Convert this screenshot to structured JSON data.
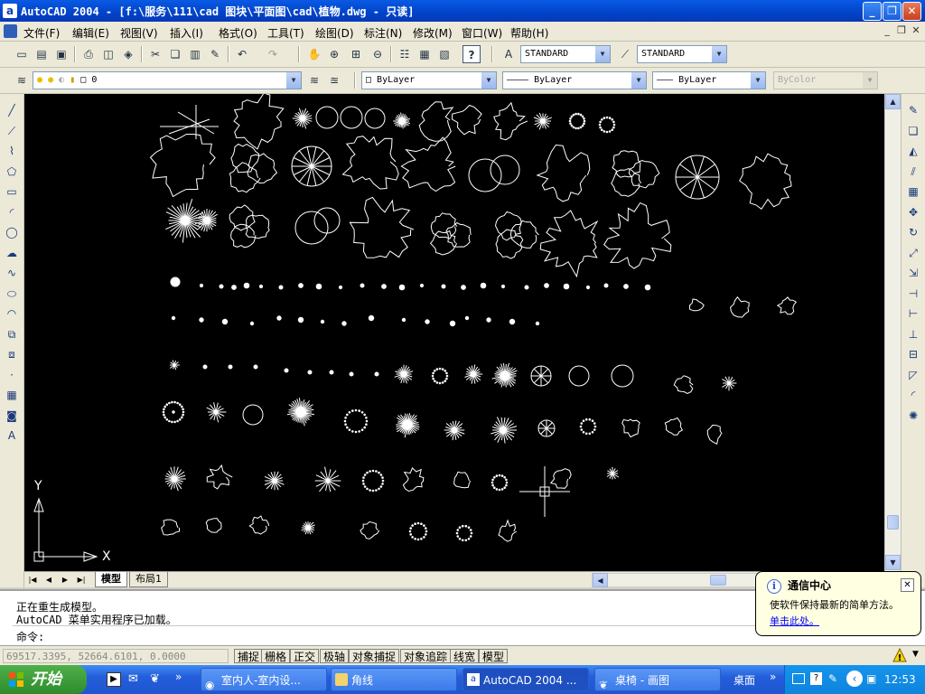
{
  "window": {
    "title": "AutoCAD 2004 - [f:\\服务\\111\\cad 图块\\平面图\\cad\\植物.dwg - 只读]",
    "app_icon": "a",
    "min_glyph": "_",
    "max_glyph": "❐",
    "close_glyph": "✕"
  },
  "menu": {
    "items": [
      "文件(F)",
      "编辑(E)",
      "视图(V)",
      "插入(I)",
      "格式(O)",
      "工具(T)",
      "绘图(D)",
      "标注(N)",
      "修改(M)",
      "窗口(W)",
      "帮助(H)"
    ],
    "mdi_min": "_",
    "mdi_restore": "❐",
    "mdi_close": "✕"
  },
  "toolbar_standard": {
    "text_style": "STANDARD",
    "dim_style": "STANDARD",
    "arrow": "▼",
    "help_glyph": "?"
  },
  "toolbar_layers": {
    "layer_name": "0",
    "color": "ByLayer",
    "linetype": "ByLayer",
    "lineweight": "ByLayer",
    "plot_style": "ByColor"
  },
  "left_palette_icons": [
    "line-icon",
    "construction-line-icon",
    "polyline-icon",
    "polygon-icon",
    "rectangle-icon",
    "arc-icon",
    "circle-icon",
    "revision-cloud-icon",
    "spline-icon",
    "ellipse-icon",
    "ellipse-arc-icon",
    "insert-block-icon",
    "make-block-icon",
    "point-icon",
    "hatch-icon",
    "region-icon",
    "multiline-text-icon"
  ],
  "right_palette_icons": [
    "erase-icon",
    "copy-icon",
    "mirror-icon",
    "offset-icon",
    "array-icon",
    "move-icon",
    "rotate-icon",
    "scale-icon",
    "stretch-icon",
    "trim-icon",
    "extend-icon",
    "break-at-point-icon",
    "break-icon",
    "chamfer-icon",
    "fillet-icon",
    "explode-icon"
  ],
  "ucs": {
    "x_label": "X",
    "y_label": "Y"
  },
  "tabs": [
    {
      "label": "模型",
      "active": true
    },
    {
      "label": "布局1",
      "active": false
    }
  ],
  "command": {
    "history": [
      "正在重生成模型。",
      "AutoCAD 菜单实用程序已加载。"
    ],
    "prompt": "命令:"
  },
  "status": {
    "coords": "69517.3395, 52664.6101, 0.0000",
    "toggles": [
      "捕捉",
      "栅格",
      "正交",
      "极轴",
      "对象捕捉",
      "对象追踪",
      "线宽",
      "模型"
    ]
  },
  "balloon": {
    "title": "通信中心",
    "message": "使软件保持最新的简单方法。",
    "link": "单击此处。",
    "close_glyph": "✕",
    "info_glyph": "i"
  },
  "taskbar": {
    "start": "开始",
    "buttons": [
      {
        "label": "室内人-室内设...",
        "active": false
      },
      {
        "label": "角线",
        "active": false
      },
      {
        "label": "AutoCAD 2004 ...",
        "active": true
      },
      {
        "label": "桌椅 - 画图",
        "active": false
      }
    ],
    "desktop": "桌面",
    "chevron": "»",
    "time": "12:53"
  },
  "colors": {
    "title_blue": "#0043c8",
    "canvas_bg": "#000000",
    "symbol_stroke": "#ffffff",
    "start_green": "#2f8c2b",
    "balloon_bg": "#ffffe1"
  }
}
